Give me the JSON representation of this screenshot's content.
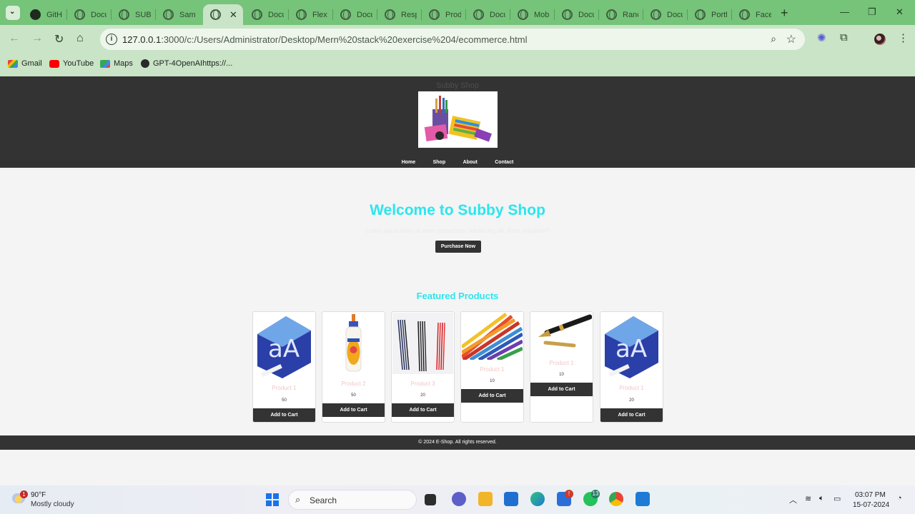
{
  "browser": {
    "tabs": [
      {
        "title": "GitHub",
        "icon": "github-icon"
      },
      {
        "title": "Docu",
        "icon": "globe-icon"
      },
      {
        "title": "SUBB",
        "icon": "globe-icon"
      },
      {
        "title": "Samp",
        "icon": "globe-icon"
      },
      {
        "title": "",
        "icon": "globe-icon",
        "active": true
      },
      {
        "title": "Docu",
        "icon": "globe-icon"
      },
      {
        "title": "Flex",
        "icon": "globe-icon"
      },
      {
        "title": "Docu",
        "icon": "globe-icon"
      },
      {
        "title": "Resp",
        "icon": "globe-icon"
      },
      {
        "title": "Prod",
        "icon": "globe-icon"
      },
      {
        "title": "Docu",
        "icon": "globe-icon"
      },
      {
        "title": "Mob",
        "icon": "globe-icon"
      },
      {
        "title": "Docu",
        "icon": "globe-icon"
      },
      {
        "title": "Ranc",
        "icon": "globe-icon"
      },
      {
        "title": "Docu",
        "icon": "globe-icon"
      },
      {
        "title": "Portf",
        "icon": "globe-icon"
      },
      {
        "title": "Face",
        "icon": "globe-icon"
      }
    ],
    "url_host": "127.0.0.1",
    "url_rest": ":3000/c:/Users/Administrator/Desktop/Mern%20stack%20exercise%204/ecommerce.html",
    "bookmarks": [
      "Gmail",
      "YouTube",
      "Maps",
      "GPT-4OpenAIhttps://..."
    ],
    "accent": "#76c37a",
    "toolbar_bg": "#c9e4c6"
  },
  "site": {
    "title": "Subby Shop",
    "nav": [
      "Home",
      "Shop",
      "About",
      "Contact"
    ],
    "hero_title": "Welcome to Subby Shop",
    "hero_subtitle": "Lorem ipsum dolor sit amet consectetur, adipisicing elit. Rem, voluptate?",
    "purchase_label": "Purchase Now",
    "featured_title": "Featured Products",
    "products": [
      {
        "name": "Product 1",
        "price": "50",
        "image": "paper-ream-image",
        "cart_label": "Add to Cart"
      },
      {
        "name": "Product 2",
        "price": "50",
        "image": "glue-bottle-image",
        "cart_label": "Add to Cart"
      },
      {
        "name": "Product 3",
        "price": "20",
        "image": "gel-refills-image",
        "cart_label": "Add to Cart"
      },
      {
        "name": "Product 1",
        "price": "10",
        "image": "colored-pencils-image",
        "cart_label": "Add to Cart"
      },
      {
        "name": "Product 1",
        "price": "10",
        "image": "fountain-pen-image",
        "cart_label": "Add to Cart"
      },
      {
        "name": "Product 1",
        "price": "20",
        "image": "paper-ream-image",
        "cart_label": "Add to Cart"
      }
    ],
    "footer": "© 2024 E-Shop. All rights reserved.",
    "accent": "#2ae6ee",
    "dark": "#333333"
  },
  "taskbar": {
    "weather_temp": "90°F",
    "weather_desc": "Mostly cloudy",
    "weather_badge": "1",
    "search_label": "Search",
    "whatsapp_badge": "13",
    "store_badge": "!",
    "time": "03:07 PM",
    "date": "15-07-2024"
  }
}
